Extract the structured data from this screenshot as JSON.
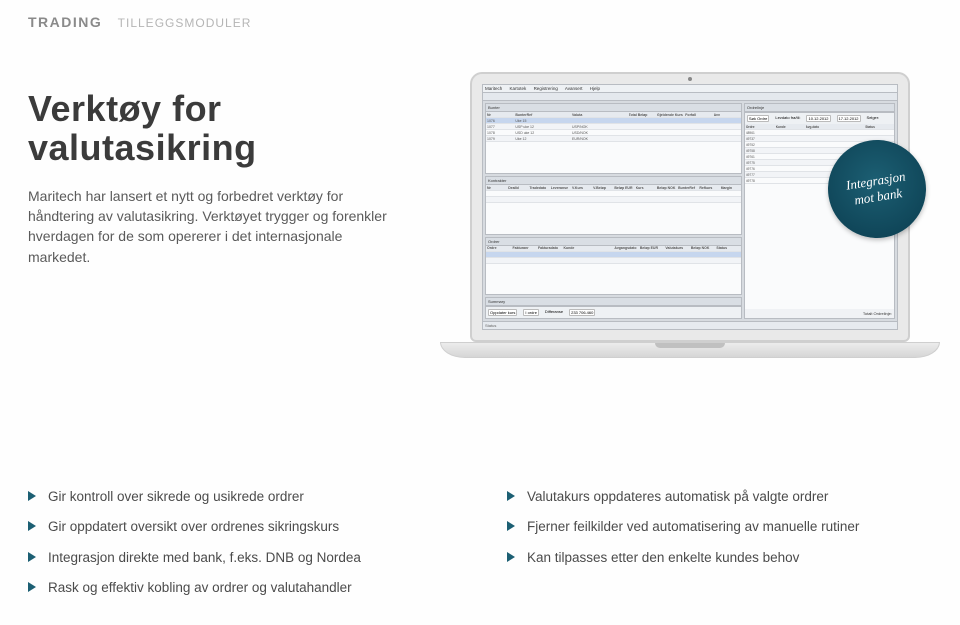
{
  "breadcrumb": {
    "main": "TRADING",
    "sub": "TILLEGGSMODULER"
  },
  "heading": "Verktøy for valutasikring",
  "intro": "Maritech har lansert et nytt og forbedret verktøy for håndtering av valutasikring. Verktøyet trygger og forenkler hverdagen for de som opererer i det internasjonale markedet.",
  "badge": {
    "line1": "Integrasjon",
    "line2": "mot bank"
  },
  "features_left": [
    "Gir kontroll over sikrede og usikrede ordrer",
    "Gir oppdatert oversikt over ordrenes sikringskurs",
    "Integrasjon direkte med bank, f.eks. DNB og Nordea",
    "Rask og effektiv kobling av ordrer og valutahandler"
  ],
  "features_right": [
    "Valutakurs oppdateres automatisk på valgte ordrer",
    "Fjerner feilkilder ved automatisering av manuelle rutiner",
    "Kan tilpasses etter den enkelte kundes behov"
  ],
  "app": {
    "menu": [
      "Maritech",
      "Kartotek",
      "Registrering",
      "Avansert",
      "Hjelp"
    ],
    "panels": {
      "bunter": "Bunter",
      "kontrakter": "Kontrakter",
      "ordrer": "Ordrer",
      "ordrelinje": "Ordrelinje",
      "summary": "Summary"
    },
    "bunter_head": [
      "Nr",
      "BunterRef",
      "",
      "Valuta",
      "",
      "Total Beløp",
      "Gjeldende Kurs",
      "Forfall",
      "Avv"
    ],
    "bunter_rows": [
      [
        "1076",
        "Uke 15",
        "",
        "",
        "",
        "",
        "",
        "",
        ""
      ],
      [
        "1077",
        "USP uke 12",
        "",
        "USP/NOK",
        "",
        "",
        "",
        "",
        ""
      ],
      [
        "1078",
        "USD uke 12",
        "",
        "USD/NOK",
        "",
        "",
        "",
        "",
        ""
      ],
      [
        "1079",
        "Uke 12",
        "",
        "EUR/NOK",
        "",
        "",
        "",
        "",
        ""
      ]
    ],
    "kontrakter_head": [
      "Nr",
      "DealId",
      "Tradedato",
      "Leveranse",
      "V.Kurs",
      "V.Beløp",
      "Beløp EUR",
      "Kurs",
      "Beløp NOK",
      "BunterRef",
      "Refkurs",
      "Margin"
    ],
    "kontrakter_rows": [
      [
        "",
        "",
        "",
        "",
        "",
        "",
        "",
        "",
        "",
        "",
        "",
        ""
      ],
      [
        "",
        "",
        "",
        "",
        "",
        "",
        "",
        "",
        "",
        "",
        "",
        ""
      ]
    ],
    "ordrer_head": [
      "Ordre",
      "Fakturanr",
      "Fakturadato",
      "Kunde",
      "",
      "Avgangsdato",
      "Beløp EUR",
      "Valutakurs",
      "Beløp NOK",
      "Status"
    ],
    "ordrer_rows": [
      [
        "",
        "",
        "",
        "",
        "",
        "",
        "",
        "",
        "",
        ""
      ],
      [
        "",
        "",
        "",
        "",
        "",
        "",
        "",
        "",
        "",
        ""
      ]
    ],
    "summary_labels": {
      "opp": "Oppdater kurs",
      "ordre": "I ordre",
      "diff": "Differanse",
      "diff_val": "233 706.460"
    },
    "ordrelinje_filters": {
      "sokordre": "Søk Ordre",
      "levdato": "Levdato fra/til:",
      "from": "10.12.2012",
      "to": "17.12.2012",
      "selger": "Selger:"
    },
    "ordrelinje_head": [
      "Ordre",
      "Kunde",
      "Avg.dato",
      "",
      "Status"
    ],
    "ordrelinje_rows": [
      [
        "48961",
        "",
        "",
        "",
        ""
      ],
      [
        "49737",
        "",
        "",
        "",
        ""
      ],
      [
        "49752",
        "",
        "",
        "",
        ""
      ],
      [
        "49758",
        "",
        "",
        "",
        ""
      ],
      [
        "49761",
        "",
        "",
        "",
        ""
      ],
      [
        "49775",
        "",
        "",
        "",
        ""
      ],
      [
        "49776",
        "",
        "",
        "",
        ""
      ],
      [
        "49777",
        "",
        "",
        "",
        ""
      ],
      [
        "49778",
        "",
        "",
        "",
        ""
      ]
    ],
    "total_label": "Totalt Ordrelinje:",
    "status": "Status"
  }
}
